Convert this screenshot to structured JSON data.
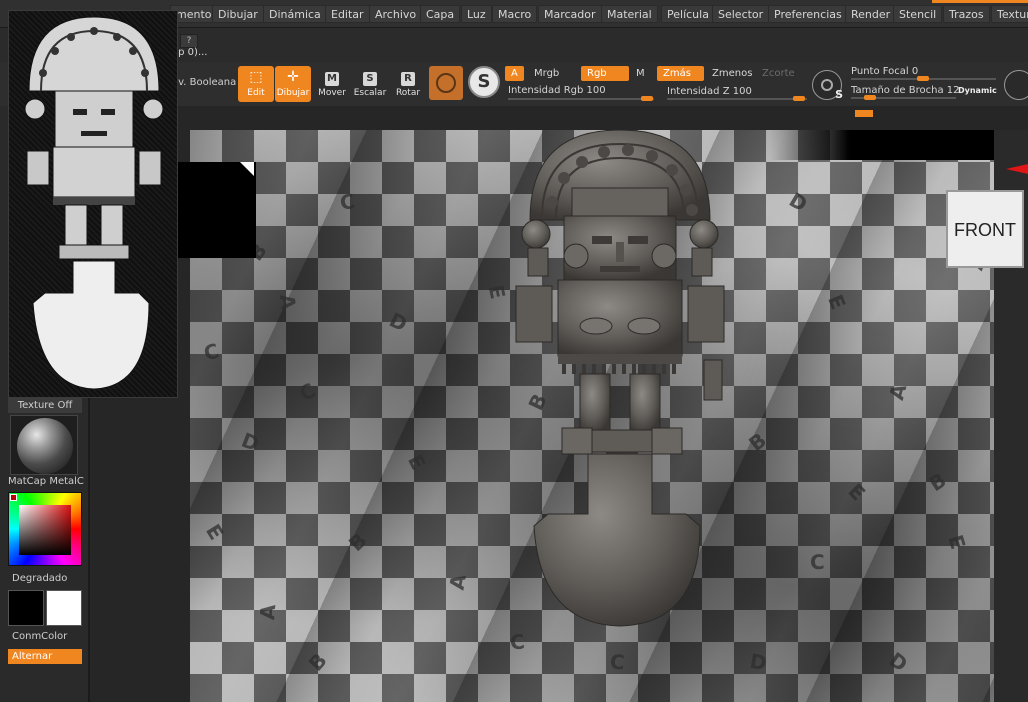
{
  "menubar": {
    "items": [
      "mento",
      "Dibujar",
      "Dinámica",
      "Editar",
      "Archivo",
      "Capa",
      "Luz",
      "Macro",
      "Marcador",
      "Material",
      "Película",
      "Selector",
      "Preferencias",
      "Render",
      "Stencil",
      "Trazos",
      "Textur"
    ]
  },
  "subbar": {
    "help_button": "?",
    "step_label": "ep 0)..."
  },
  "toolbar": {
    "boolean_label": "ev. Booleana",
    "edit_label": "Edit",
    "draw_label": "Dibujar",
    "move_label": "Mover",
    "move_glyph": "M",
    "scale_label": "Escalar",
    "scale_glyph": "S",
    "rotate_label": "Rotar",
    "rotate_glyph": "R",
    "symmetry_glyph": "S"
  },
  "modes": {
    "a": "A",
    "mrgb": "Mrgb",
    "rgb": "Rgb",
    "m": "M",
    "zadd": "Zmás",
    "zsub": "Zmenos",
    "zcut": "Zcorte"
  },
  "sliders": {
    "rgb_intensity_label": "Intensidad Rgb",
    "rgb_intensity_value": "100",
    "z_intensity_label": "Intensidad Z",
    "z_intensity_value": "100",
    "focal_label": "Punto Focal",
    "focal_value": "0",
    "brush_size_label": "Tamaño de Brocha",
    "brush_size_value": "12",
    "dynamic_label": "Dynamic",
    "s_glyph": "S"
  },
  "leftpanel": {
    "texture_label": "Texture Off",
    "matcap_label": "MatCap MetalC",
    "gradient_label": "Degradado",
    "conmcolor_label": "ConmColor",
    "toggle_label": "Alternar"
  },
  "viewport": {
    "view_cube_label": "FRONT",
    "cloth_letters": [
      "A",
      "B",
      "C",
      "D",
      "E",
      "A",
      "B",
      "C",
      "D",
      "E",
      "A",
      "B",
      "C",
      "D",
      "E",
      "A",
      "B",
      "C",
      "D",
      "E",
      "A",
      "B",
      "C",
      "D",
      "E",
      "B",
      "C",
      "D",
      "E",
      "A"
    ]
  },
  "colors": {
    "accent": "#f0861f",
    "panel": "#2a2a2a",
    "menubar": "#303030"
  }
}
